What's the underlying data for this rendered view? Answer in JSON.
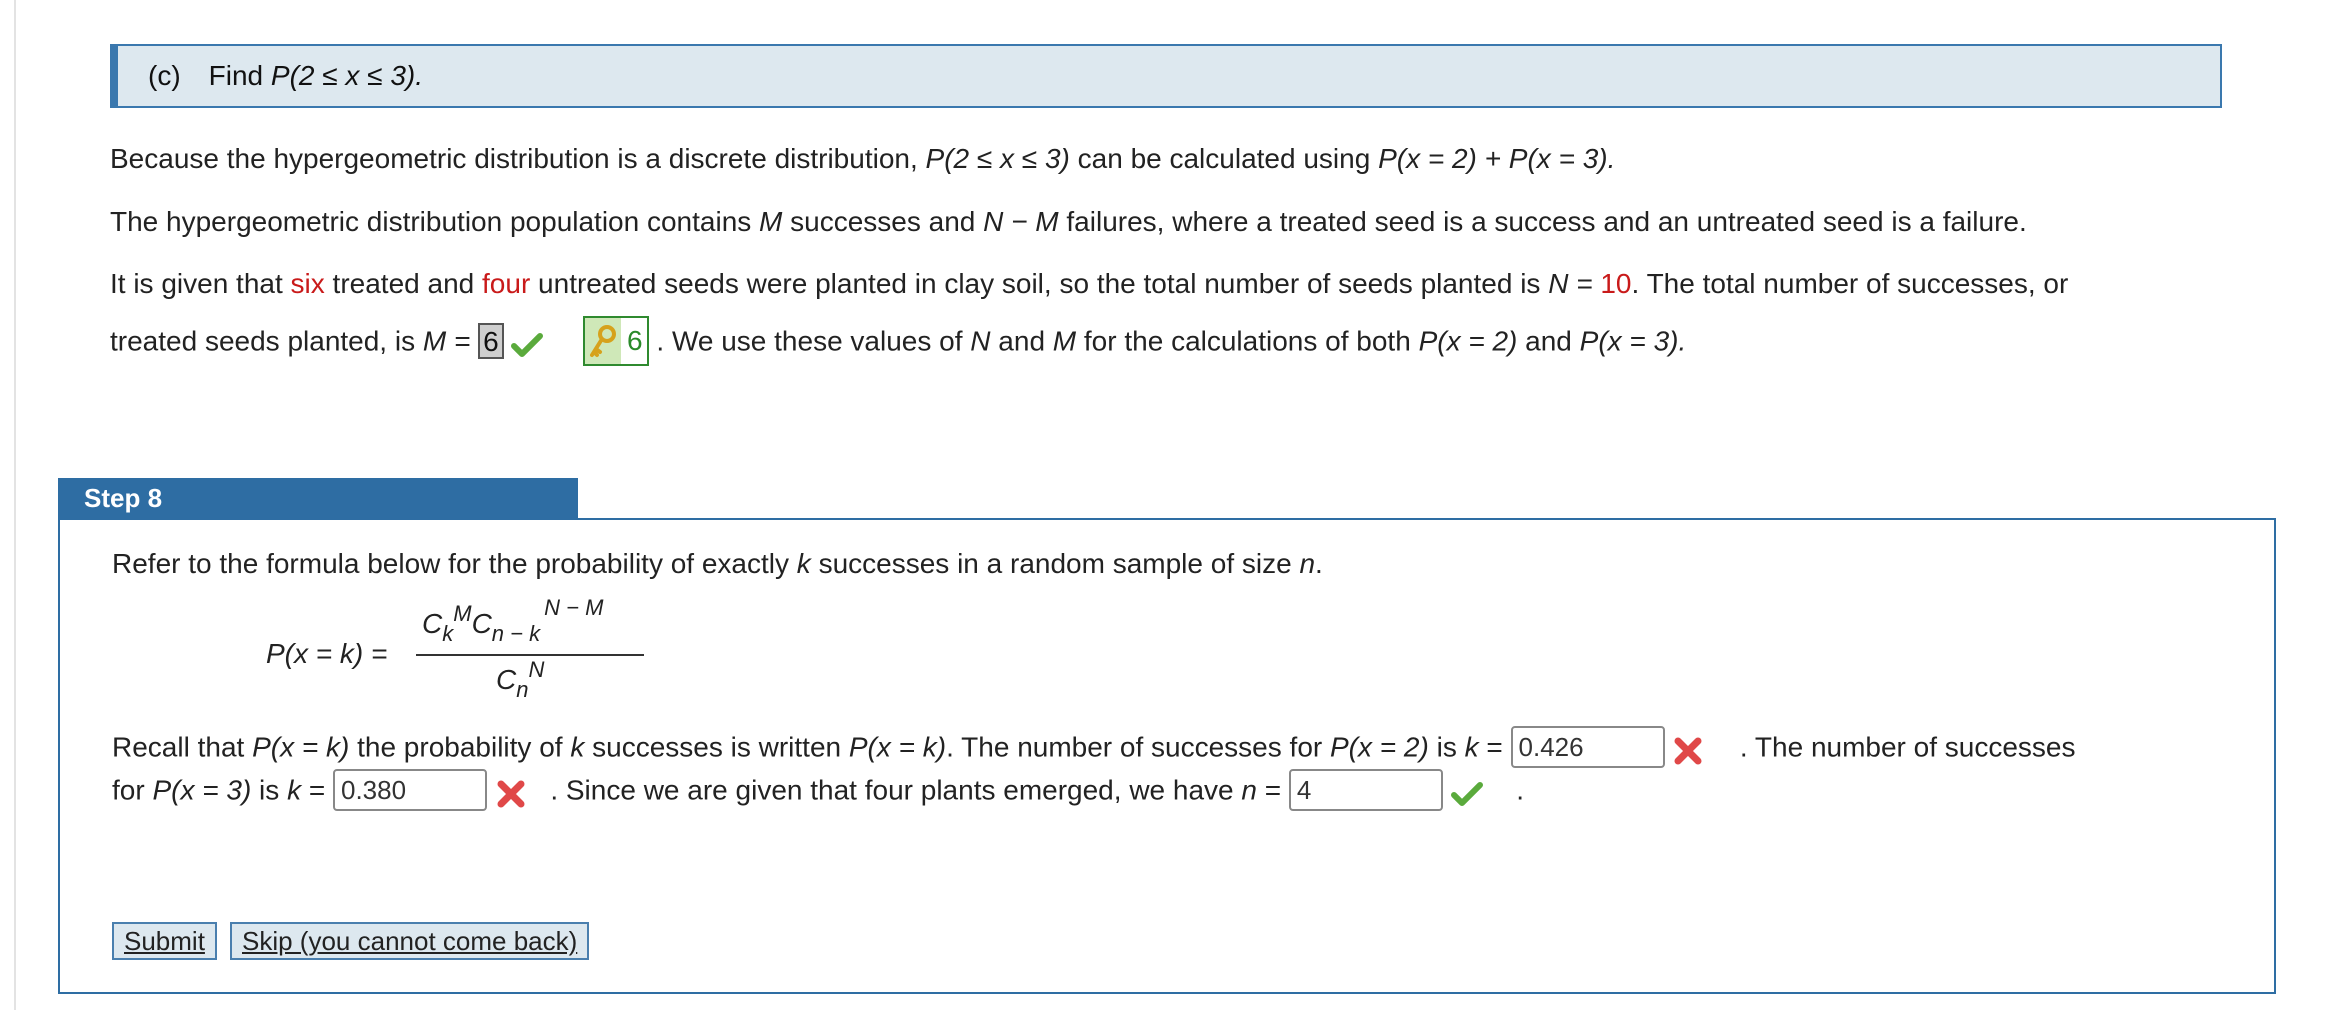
{
  "part": {
    "label": "(c)",
    "prompt_prefix": "Find ",
    "prompt_math": "P(2 ≤ x ≤ 3)."
  },
  "para1": {
    "a": "Because the hypergeometric distribution is a discrete distribution, ",
    "m1": "P(2 ≤ x ≤ 3)",
    "b": " can be calculated using ",
    "m2": "P(x = 2) + P(x = 3)."
  },
  "para2": {
    "a": "The hypergeometric distribution population contains ",
    "m1": "M",
    "b": " successes and ",
    "m2": "N − M",
    "c": " failures, where a treated seed is a success and an untreated seed is a failure."
  },
  "para3": {
    "a": "It is given that ",
    "six": "six",
    "b": " treated and ",
    "four": "four",
    "c": " untreated seeds were planted in clay soil, so the total number of seeds planted is ",
    "n_eq": "N = ",
    "ten": "10",
    "d": ". The total number of successes, or"
  },
  "para4": {
    "a": "treated seeds planted, is ",
    "m_eq": "M = ",
    "m_value": "6",
    "key_value": "6",
    "b": " . We use these values of ",
    "n": "N",
    "and": " and ",
    "m": "M",
    "c": " for the calculations of both ",
    "p2": "P(x = 2)",
    "and2": " and ",
    "p3": "P(x = 3)."
  },
  "step": {
    "title": "Step 8",
    "intro_a": "Refer to the formula below for the probability of exactly ",
    "intro_k": "k",
    "intro_b": " successes in a random sample of size ",
    "intro_n": "n",
    "intro_c": "."
  },
  "formula": {
    "lhs": "P(x = k) =",
    "c1": "C",
    "k": "k",
    "M": "M",
    "c2": "C",
    "nk": "n − k",
    "NM": "N − M",
    "c3": "C",
    "n": "n",
    "N": "N"
  },
  "recall": {
    "a": "Recall that ",
    "pk": "P(x = k)",
    "b": " the probability of ",
    "k": "k",
    "c": " successes is written ",
    "pk2": "P(x = k)",
    "d": ". The number of successes for ",
    "p2": "P(x = 2)",
    "e": " is ",
    "keq": "k",
    "eq": " = ",
    "k2_value": "0.426",
    "f": " . The number of successes",
    "g": "for ",
    "p3": "P(x = 3)",
    "h": " is ",
    "keq2": "k",
    "eq2": " = ",
    "k3_value": "0.380",
    "i": " . Since we are given that four plants emerged, we have ",
    "n": "n",
    "eq3": " = ",
    "n_value": "4",
    "j": " ."
  },
  "buttons": {
    "submit": "Submit",
    "skip": "Skip (you cannot come back)"
  },
  "colors": {
    "accent": "#2e6da3",
    "highlight": "#c91a1a",
    "correct": "#5aaa3c",
    "incorrect": "#e04848"
  },
  "icons": [
    "checkmark-icon",
    "key-icon",
    "x-mark-icon"
  ]
}
